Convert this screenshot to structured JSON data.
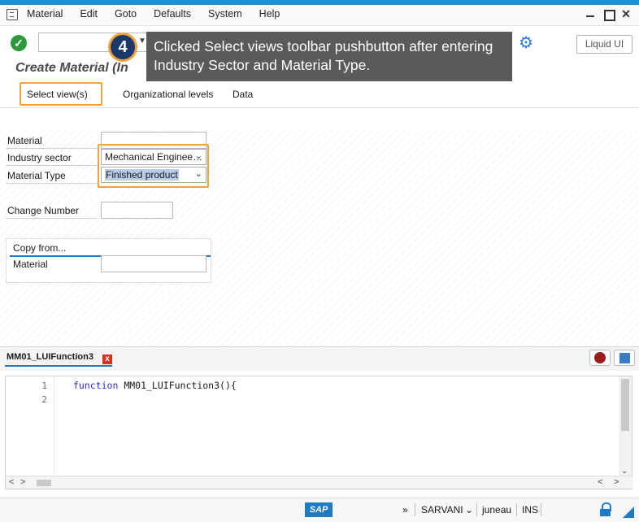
{
  "menu": {
    "items": [
      {
        "label": "Material"
      },
      {
        "label": "Edit"
      },
      {
        "label": "Goto"
      },
      {
        "label": "Defaults"
      },
      {
        "label": "System"
      },
      {
        "label": "Help"
      }
    ]
  },
  "toolbar": {
    "liquid_ui_label": "Liquid UI"
  },
  "callout": {
    "step": "4",
    "text": "Clicked Select views toolbar pushbutton after entering Industry Sector and Material Type."
  },
  "page": {
    "title": "Create Material (In"
  },
  "tabs": [
    {
      "label": "Select view(s)"
    },
    {
      "label": "Organizational levels"
    },
    {
      "label": "Data"
    }
  ],
  "form": {
    "material_label": "Material",
    "material_value": "",
    "industry_label": "Industry sector",
    "industry_value": "Mechanical Enginee…",
    "type_label": "Material Type",
    "type_value": "Finished product",
    "change_label": "Change Number",
    "change_value": ""
  },
  "copy_from": {
    "header": "Copy from...",
    "material_label": "Material",
    "material_value": ""
  },
  "editor": {
    "tab_label": "MM01_LUIFunction3",
    "line_numbers": [
      "1",
      "2"
    ],
    "code_keyword": "function",
    "code_rest": " MM01_LUIFunction3(){"
  },
  "status": {
    "chevrons": "»",
    "user": "SARVANI",
    "server": "juneau",
    "mode": "INS",
    "sap_logo": "SAP"
  },
  "colors": {
    "accent_blue": "#1f7ac4",
    "highlight_orange": "#f0a33a",
    "callout_bg": "#5a5a5a",
    "badge_bg": "#1b3a6b",
    "ok_green": "#2c9a3b"
  }
}
